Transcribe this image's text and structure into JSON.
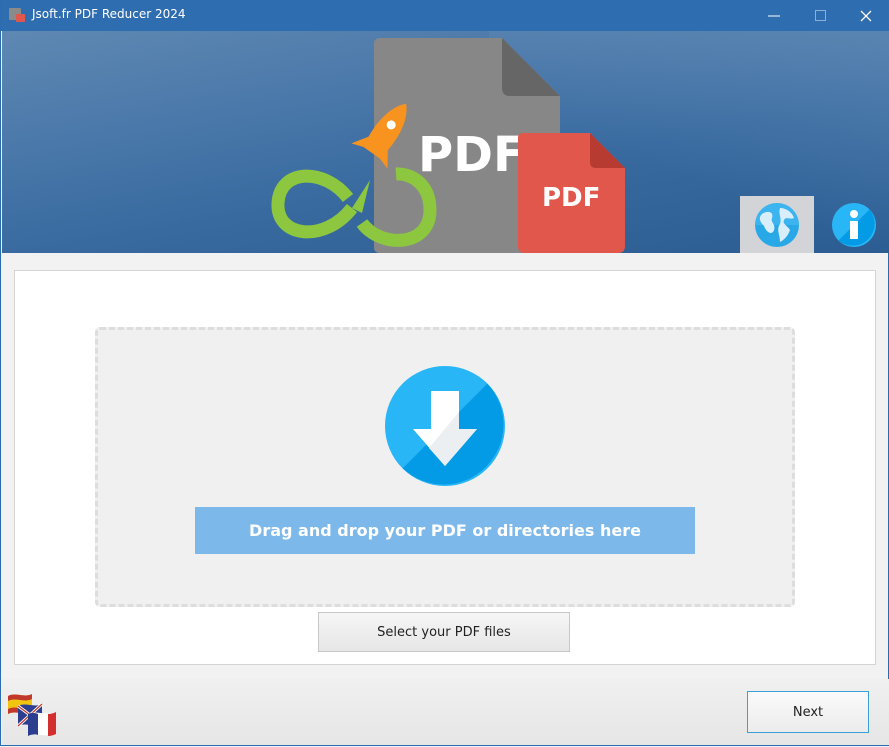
{
  "window": {
    "title": "Jsoft.fr PDF Reducer 2024",
    "controls": {
      "minimize": "—",
      "maximize": "☐",
      "close": "✕"
    }
  },
  "header": {
    "logo_text_large": "PDF",
    "logo_text_small": "PDF",
    "language_button_icon": "globe-icon",
    "info_button_icon": "info-icon"
  },
  "dropzone": {
    "icon": "download-arrow-icon",
    "label": "Drag and drop your PDF or directories here"
  },
  "buttons": {
    "select_files": "Select your PDF files",
    "next": "Next"
  },
  "footer": {
    "language_flags_icon": "language-flags-icon"
  },
  "colors": {
    "titlebar": "#2e6db0",
    "drop_label_bg": "#7db8ea",
    "accent_blue": "#29b6f6",
    "pdf_red": "#e2574c",
    "rocket_orange": "#f7931e",
    "infinity_green": "#8dc63f"
  }
}
